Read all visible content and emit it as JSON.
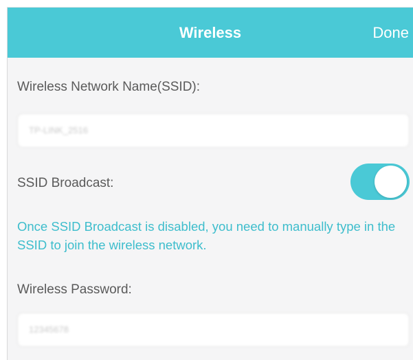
{
  "header": {
    "title": "Wireless",
    "done_label": "Done"
  },
  "ssid": {
    "label": "Wireless Network Name(SSID):",
    "value": "TP-LINK_2516"
  },
  "broadcast": {
    "label": "SSID Broadcast:",
    "enabled": true
  },
  "hint": "Once SSID Broadcast is disabled, you need to manually type in the SSID to join the wireless network.",
  "password": {
    "label": "Wireless Password:",
    "value": "12345678"
  },
  "colors": {
    "accent": "#4ac9d6",
    "hint_text": "#3dbdcc",
    "background": "#f5f5f6"
  }
}
